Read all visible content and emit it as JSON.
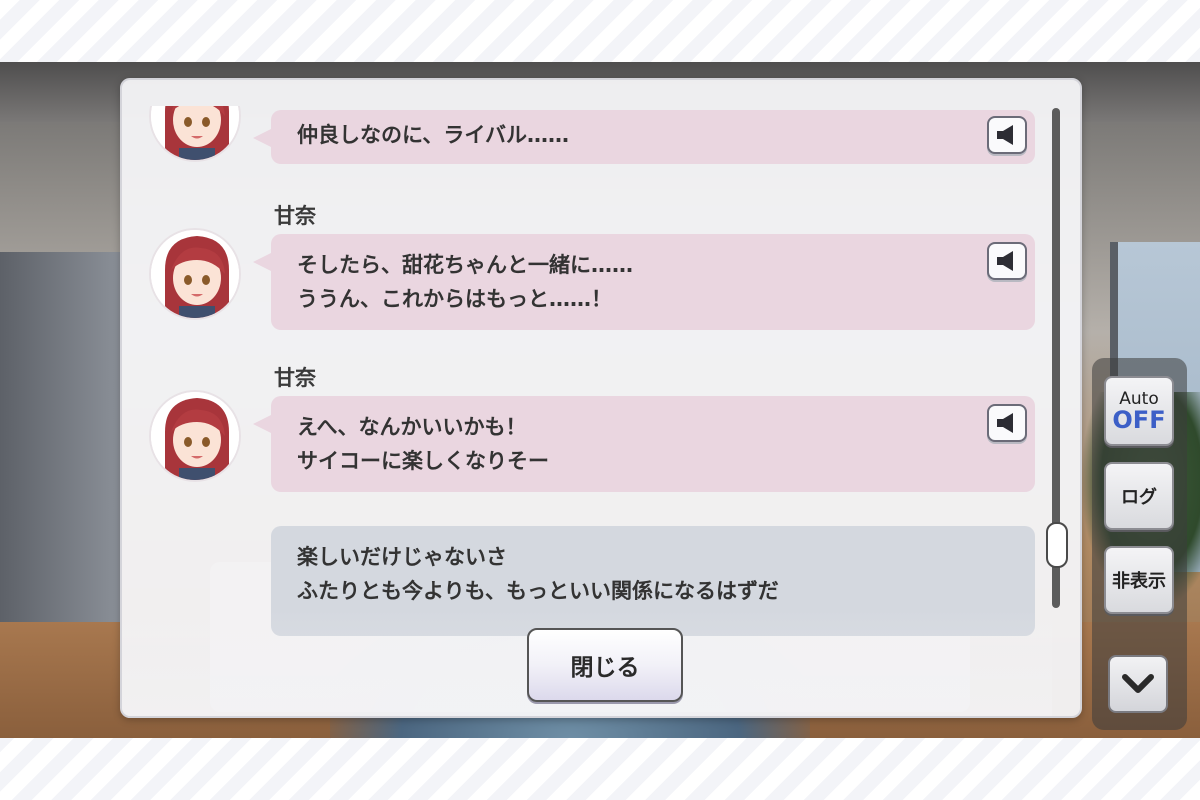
{
  "modal": {
    "close_label": "閉じる",
    "entries": [
      {
        "speaker": "",
        "lines": [
          "仲良しなのに、ライバル……"
        ],
        "type": "character",
        "has_avatar": true
      },
      {
        "speaker": "甘奈",
        "lines": [
          "そしたら、甜花ちゃんと一緒に……",
          "ううん、これからはもっと……！"
        ],
        "type": "character",
        "has_avatar": true
      },
      {
        "speaker": "甘奈",
        "lines": [
          "えへ、なんかいいかも！",
          "サイコーに楽しくなりそー"
        ],
        "type": "character",
        "has_avatar": true
      },
      {
        "speaker": "",
        "lines": [
          "楽しいだけじゃないさ",
          "ふたりとも今よりも、もっといい関係になるはずだ"
        ],
        "type": "player",
        "has_avatar": false
      }
    ]
  },
  "controls": {
    "auto_label": "Auto",
    "auto_state": "OFF",
    "log_label": "ログ",
    "hide_label": "非表示"
  },
  "colors": {
    "character_bubble": "#ead6e0",
    "player_bubble": "#d4d8df",
    "auto_off": "#3c5fc7"
  }
}
